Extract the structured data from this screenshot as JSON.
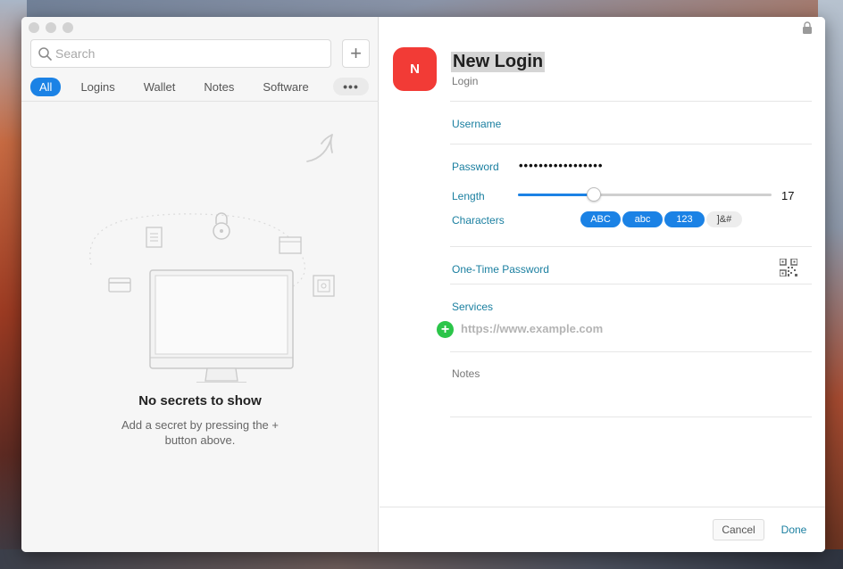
{
  "colors": {
    "accent": "#1b82e5",
    "field_label": "#1a7fa0",
    "avatar_bg": "#f23b36",
    "add_service": "#2bc549"
  },
  "sidebar": {
    "search_placeholder": "Search",
    "add_label": "+",
    "tabs": [
      {
        "label": "All",
        "active": true
      },
      {
        "label": "Logins",
        "active": false
      },
      {
        "label": "Wallet",
        "active": false
      },
      {
        "label": "Notes",
        "active": false
      },
      {
        "label": "Software",
        "active": false
      }
    ],
    "more_label": "•••",
    "empty_title": "No secrets to show",
    "empty_subtitle": "Add a secret by pressing the + button above."
  },
  "detail": {
    "avatar_letter": "N",
    "title": "New Login",
    "type": "Login",
    "username_label": "Username",
    "password_label": "Password",
    "password_mask": "•••••••••••••••••",
    "length_label": "Length",
    "length_value": "17",
    "length_fraction": 0.3,
    "characters_label": "Characters",
    "char_options": [
      {
        "label": "ABC",
        "enabled": true
      },
      {
        "label": "abc",
        "enabled": true
      },
      {
        "label": "123",
        "enabled": true
      },
      {
        "label": "]&#",
        "enabled": false
      }
    ],
    "otp_label": "One-Time Password",
    "services_label": "Services",
    "service_placeholder": "https://www.example.com",
    "add_service_label": "+",
    "notes_label": "Notes"
  },
  "footer": {
    "cancel_label": "Cancel",
    "done_label": "Done"
  }
}
